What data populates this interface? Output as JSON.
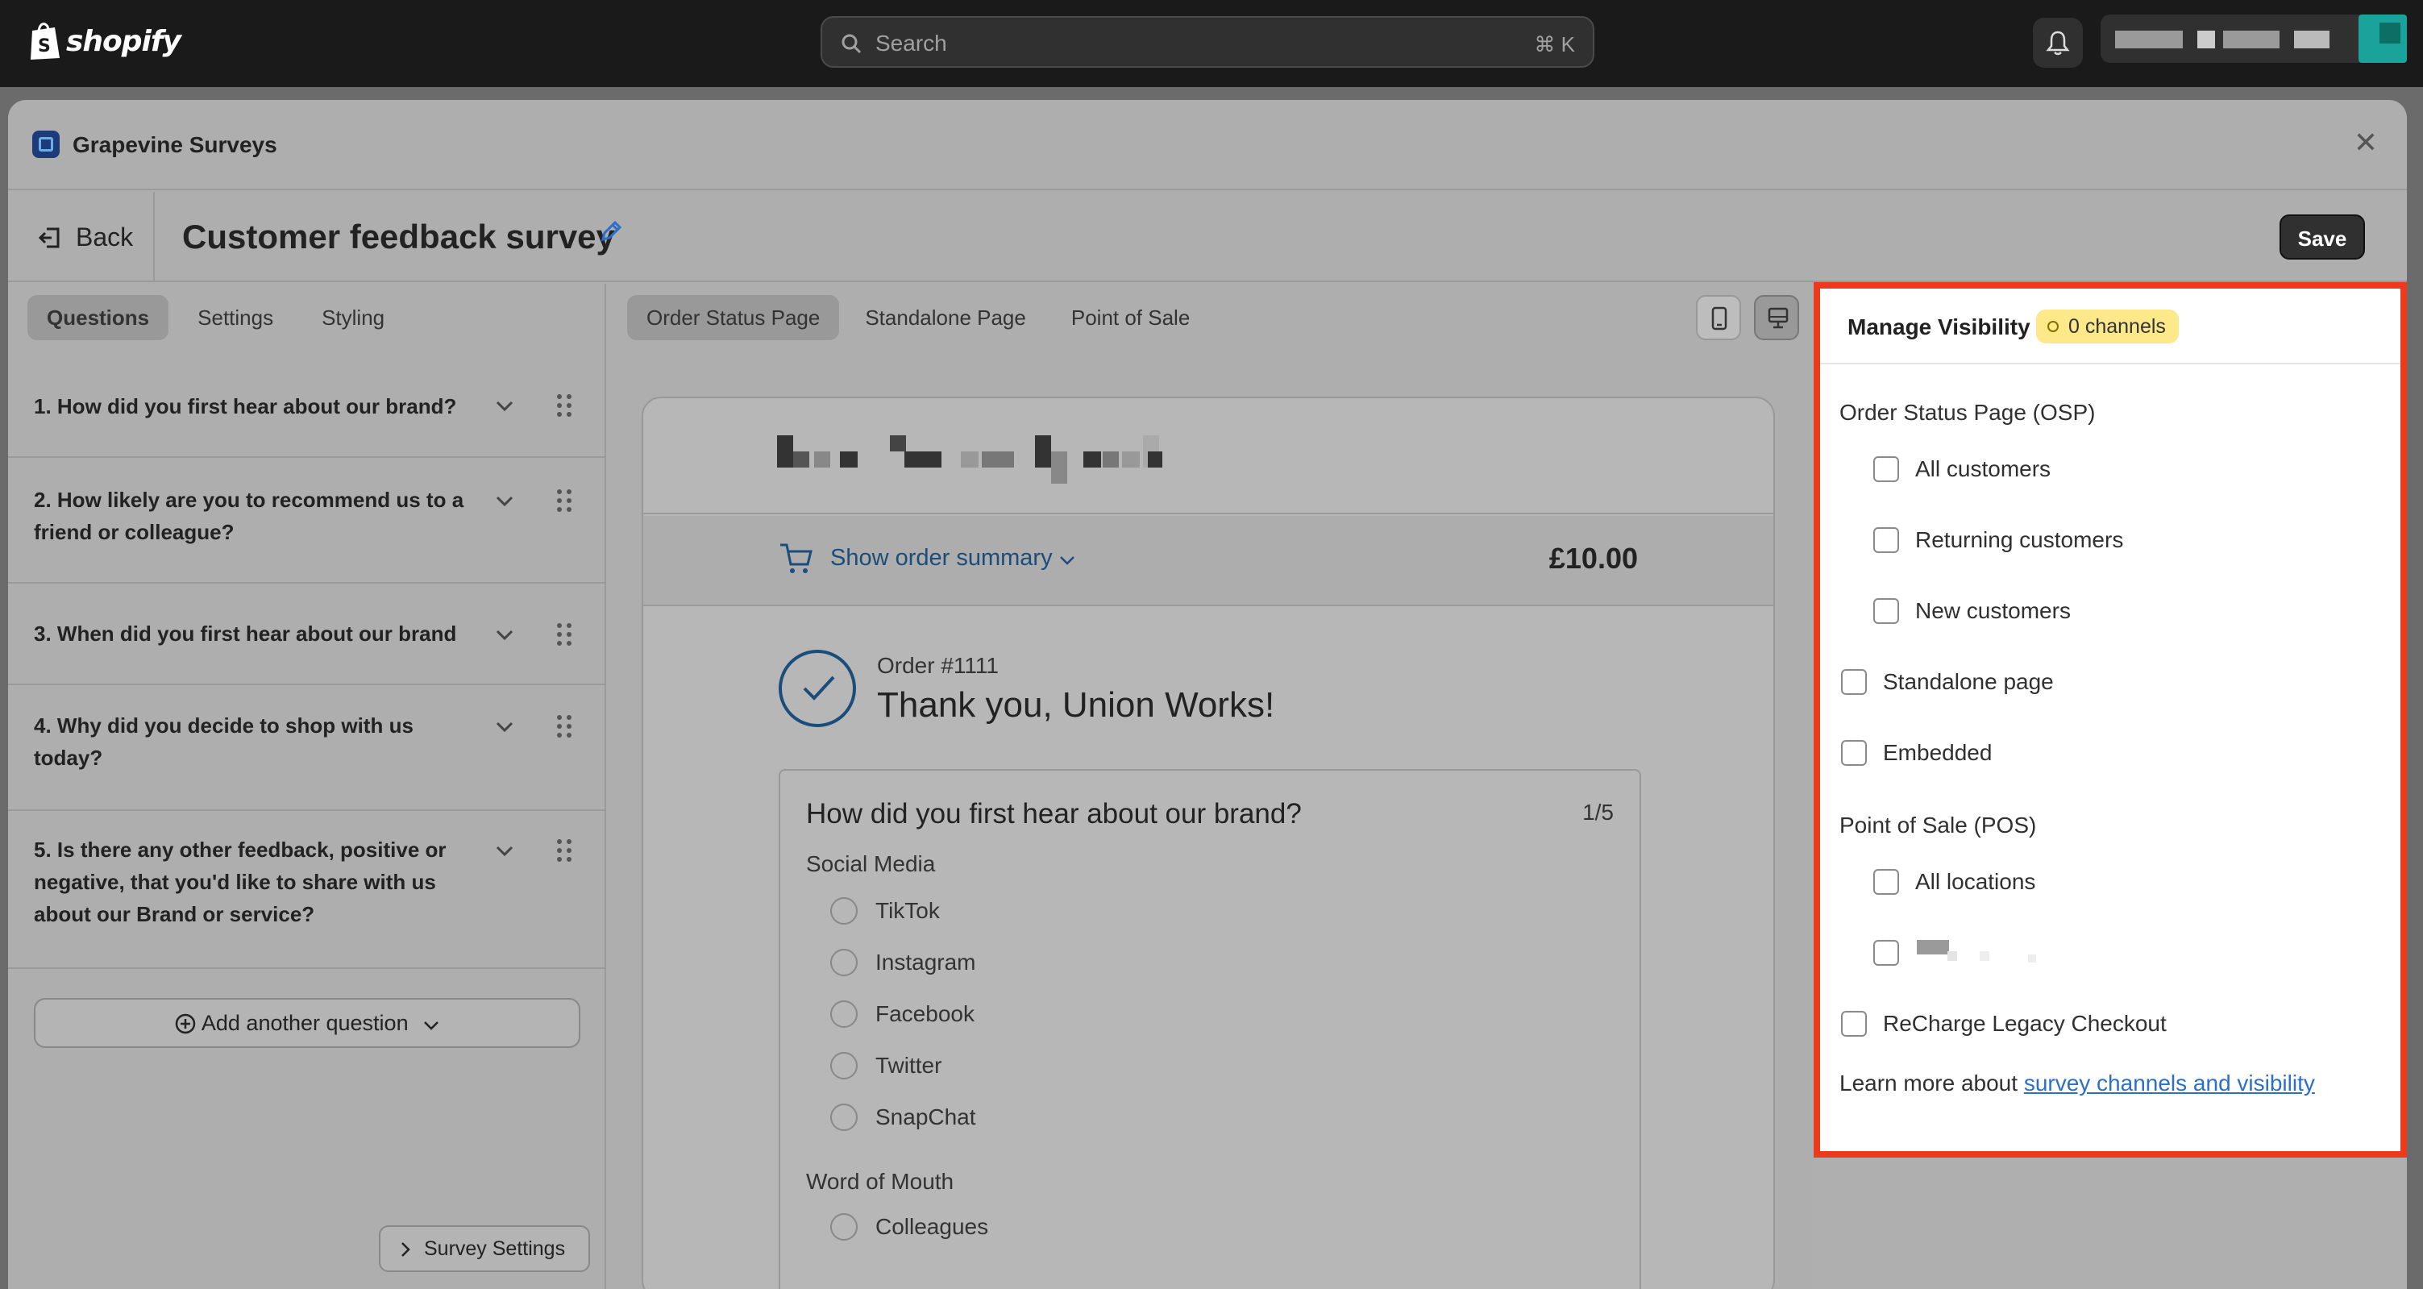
{
  "topbar": {
    "brand": "shopify",
    "search_placeholder": "Search",
    "search_shortcut": "⌘ K"
  },
  "app": {
    "name": "Grapevine Surveys",
    "close_icon": "close-icon"
  },
  "header": {
    "back_label": "Back",
    "title": "Customer feedback survey",
    "save_label": "Save"
  },
  "left": {
    "tabs": [
      "Questions",
      "Settings",
      "Styling"
    ],
    "questions": [
      "1. How did you first hear about our brand?",
      "2. How likely are you to recommend us to a friend or colleague?",
      "3. When did you first hear about our brand",
      "4. Why did you decide to shop with us today?",
      "5. Is there any other feedback, positive or negative, that you'd like to share with us about our Brand or service?"
    ],
    "add_question_label": "Add another question",
    "survey_settings_label": "Survey Settings"
  },
  "preview": {
    "tabs": [
      "Order Status Page",
      "Standalone Page",
      "Point of Sale"
    ],
    "show_summary": "Show order summary",
    "price": "£10.00",
    "order_number": "Order #1111",
    "thanks": "Thank you, Union Works!",
    "question": "How did you first hear about our brand?",
    "progress": "1/5",
    "group1": "Social Media",
    "group1_options": [
      "TikTok",
      "Instagram",
      "Facebook",
      "Twitter",
      "SnapChat"
    ],
    "group2": "Word of Mouth",
    "group2_options": [
      "Colleagues"
    ]
  },
  "visibility": {
    "title": "Manage Visibility",
    "badge": "0 channels",
    "osp_heading": "Order Status Page (OSP)",
    "osp_options": [
      "All customers",
      "Returning customers",
      "New customers"
    ],
    "standalone": "Standalone page",
    "embedded": "Embedded",
    "pos_heading": "Point of Sale (POS)",
    "pos_options": [
      "All locations"
    ],
    "recharge": "ReCharge Legacy Checkout",
    "learn_prefix": "Learn more about ",
    "learn_link": "survey channels and visibility"
  }
}
